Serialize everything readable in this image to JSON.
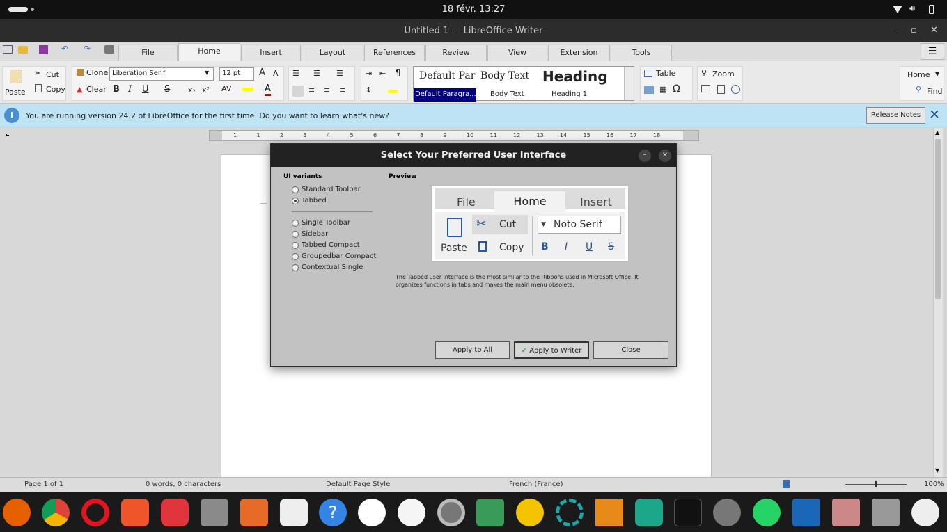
{
  "topbar": {
    "datetime": "18 févr.  13:27"
  },
  "window": {
    "title": "Untitled 1 — LibreOffice Writer",
    "minimize_glyph": "_",
    "maximize_glyph": "▫",
    "close_glyph": "✕"
  },
  "tabs": [
    "File",
    "Home",
    "Insert",
    "Layout",
    "References",
    "Review",
    "View",
    "Extension",
    "Tools"
  ],
  "ribbon": {
    "paste": "Paste",
    "cut": "Cut",
    "copy": "Copy",
    "clone": "Clone",
    "clear": "Clear",
    "font_name": "Liberation Serif",
    "font_size": "12 pt",
    "bold": "B",
    "italic": "I",
    "underline": "U",
    "strike": "S",
    "subscript": "x₂",
    "superscript": "x²",
    "styles": [
      {
        "preview": "Default Paragr",
        "name": "Default Paragra..."
      },
      {
        "preview": "Body Text",
        "name": "Body Text"
      },
      {
        "preview": "Heading",
        "name": "Heading 1"
      }
    ],
    "table": "Table",
    "zoom": "Zoom",
    "find": "Find",
    "home_select": "Home"
  },
  "infobar": {
    "message": "You are running version 24.2 of LibreOffice for the first time. Do you want to learn what's new?",
    "button": "Release Notes"
  },
  "ruler": {
    "ticks": [
      "1",
      "1",
      "2",
      "3",
      "4",
      "5",
      "6",
      "7",
      "8",
      "9",
      "10",
      "11",
      "12",
      "13",
      "14",
      "15",
      "16",
      "17",
      "18"
    ]
  },
  "dialog": {
    "title": "Select Your Preferred User Interface",
    "variants_heading": "UI variants",
    "preview_heading": "Preview",
    "variants": [
      "Standard Toolbar",
      "Tabbed",
      "Single Toolbar",
      "Sidebar",
      "Tabbed Compact",
      "Groupedbar Compact",
      "Contextual Single"
    ],
    "selected": "Tabbed",
    "preview": {
      "tabs": [
        "File",
        "Home",
        "Insert"
      ],
      "paste": "Paste",
      "cut": "Cut",
      "copy": "Copy",
      "font": "Noto Serif",
      "bold": "B",
      "italic": "I",
      "underline": "U",
      "strike": "S"
    },
    "description": "The Tabbed user interface is the most similar to the Ribbons used in Microsoft Office. It organizes functions in tabs and makes the main menu obsolete.",
    "buttons": {
      "apply_all": "Apply to All",
      "apply_writer": "Apply to Writer",
      "close": "Close"
    }
  },
  "status": {
    "page": "Page 1 of 1",
    "words": "0 words, 0 characters",
    "style": "Default Page Style",
    "language": "French (France)",
    "zoom": "100%"
  },
  "dock": [
    "firefox",
    "chrome",
    "opera",
    "brave",
    "vivaldi",
    "files",
    "app-store",
    "bag",
    "help",
    "slack",
    "music",
    "settings",
    "layers",
    "yellow-circle",
    "target",
    "xmind",
    "green-app",
    "affinity",
    "gimp",
    "whatsapp",
    "writer",
    "doc1",
    "ssd",
    "ubuntu"
  ],
  "colors": {
    "accent": "#000080",
    "infobar": "#bde3f5",
    "dock": "#1a1a1a"
  }
}
